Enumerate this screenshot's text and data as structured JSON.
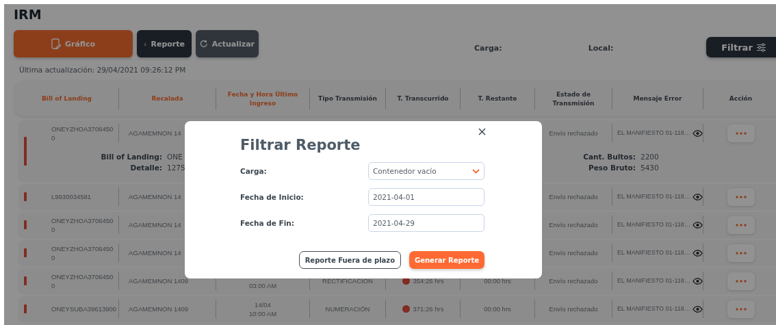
{
  "header": {
    "title": "IRM"
  },
  "toolbar": {
    "buttons": [
      {
        "label": "Gráfico",
        "kind": "primary"
      },
      {
        "label": "Reporte",
        "kind": "dark"
      },
      {
        "label": "Actualizar",
        "kind": "secondary"
      }
    ],
    "filters": [
      {
        "label": "Carga:"
      },
      {
        "label": "Local:"
      }
    ],
    "filter_button": "Filtrar"
  },
  "last_update": "Última actualización: 29/04/2021 09:26:12 PM",
  "table": {
    "columns": [
      {
        "label": "Bill of Landing",
        "highlighted": true
      },
      {
        "label": "Recalada",
        "highlighted": true
      },
      {
        "label": "Fecha y Hora Último Ingreso",
        "highlighted": true
      },
      {
        "label": "Tipo Transmisión",
        "highlighted": false
      },
      {
        "label": "T. Transcurrido",
        "highlighted": false
      },
      {
        "label": "T. Restante",
        "highlighted": false
      },
      {
        "label": "Estado de Transmisión",
        "highlighted": false
      },
      {
        "label": "Mensaje Error",
        "highlighted": false
      },
      {
        "label": "Acción",
        "highlighted": false
      }
    ],
    "rows": [
      {
        "bill": [
          "ONEYZHOA3706450",
          "0"
        ],
        "recalada": "AGAMEMNON 14",
        "estado": "Envío rechazado",
        "mensaje": "EL MANIFIESTO 01-118…",
        "detail": {
          "left": [
            {
              "key": "Bill of Landing:",
              "value": "ONE"
            },
            {
              "key": "Detalle:",
              "value": "1275"
            }
          ],
          "right": [
            {
              "key": "Cant. Bultos:",
              "value": "2200"
            },
            {
              "key": "Peso Bruto:",
              "value": "5430"
            }
          ]
        }
      },
      {
        "bill": [
          "L9930034581"
        ],
        "recalada": "AGAMEMNON 14",
        "estado": "Envío rechazado",
        "mensaje": "EL MANIFIESTO 01-118…"
      },
      {
        "bill": [
          "ONEYZHOA3706450",
          "0"
        ],
        "recalada": "AGAMEMNON 14",
        "estado": "Envío rechazado",
        "mensaje": "EL MANIFIESTO 01-118…"
      },
      {
        "bill": [
          "ONEYZHOA3706450",
          "0"
        ],
        "recalada": "AGAMEMNON 14",
        "estado": "Envío rechazado",
        "mensaje": "EL MANIFIESTO 01-118…"
      },
      {
        "bill": [
          "ONEYZHOA3706450",
          "0"
        ],
        "recalada": "AGAMEMNON 1409",
        "fecha": [
          "03:00 AM"
        ],
        "tipo": "RECTIFICACIÓN",
        "transcurrido": "354:26 hrs",
        "restante": "00:00 hrs",
        "estado": "Envío rechazado",
        "mensaje": "EL MANIFIESTO 01-118…"
      },
      {
        "bill": [
          "ONEYSUBA39613900"
        ],
        "recalada": "AGAMEMNON 1409",
        "fecha": [
          "14/04",
          "10:00 AM"
        ],
        "tipo": "NUMERACIÓN",
        "transcurrido": "371:26 hrs",
        "restante": "00:00 hrs",
        "estado": "Envío rechazado",
        "mensaje": "EL MANIFIESTO 01-118…"
      }
    ]
  },
  "modal": {
    "title": "Filtrar Reporte",
    "fields": [
      {
        "label": "Carga:",
        "kind": "select",
        "value": "Contenedor vacío"
      },
      {
        "label": "Fecha de Inicio:",
        "kind": "date",
        "value": "2021-04-01"
      },
      {
        "label": "Fecha de Fin:",
        "kind": "date",
        "value": "2021-04-29"
      }
    ],
    "buttons": [
      {
        "label": "Reporte Fuera de plazo",
        "kind": "outline"
      },
      {
        "label": "Generar Reporte",
        "kind": "primary"
      }
    ]
  }
}
